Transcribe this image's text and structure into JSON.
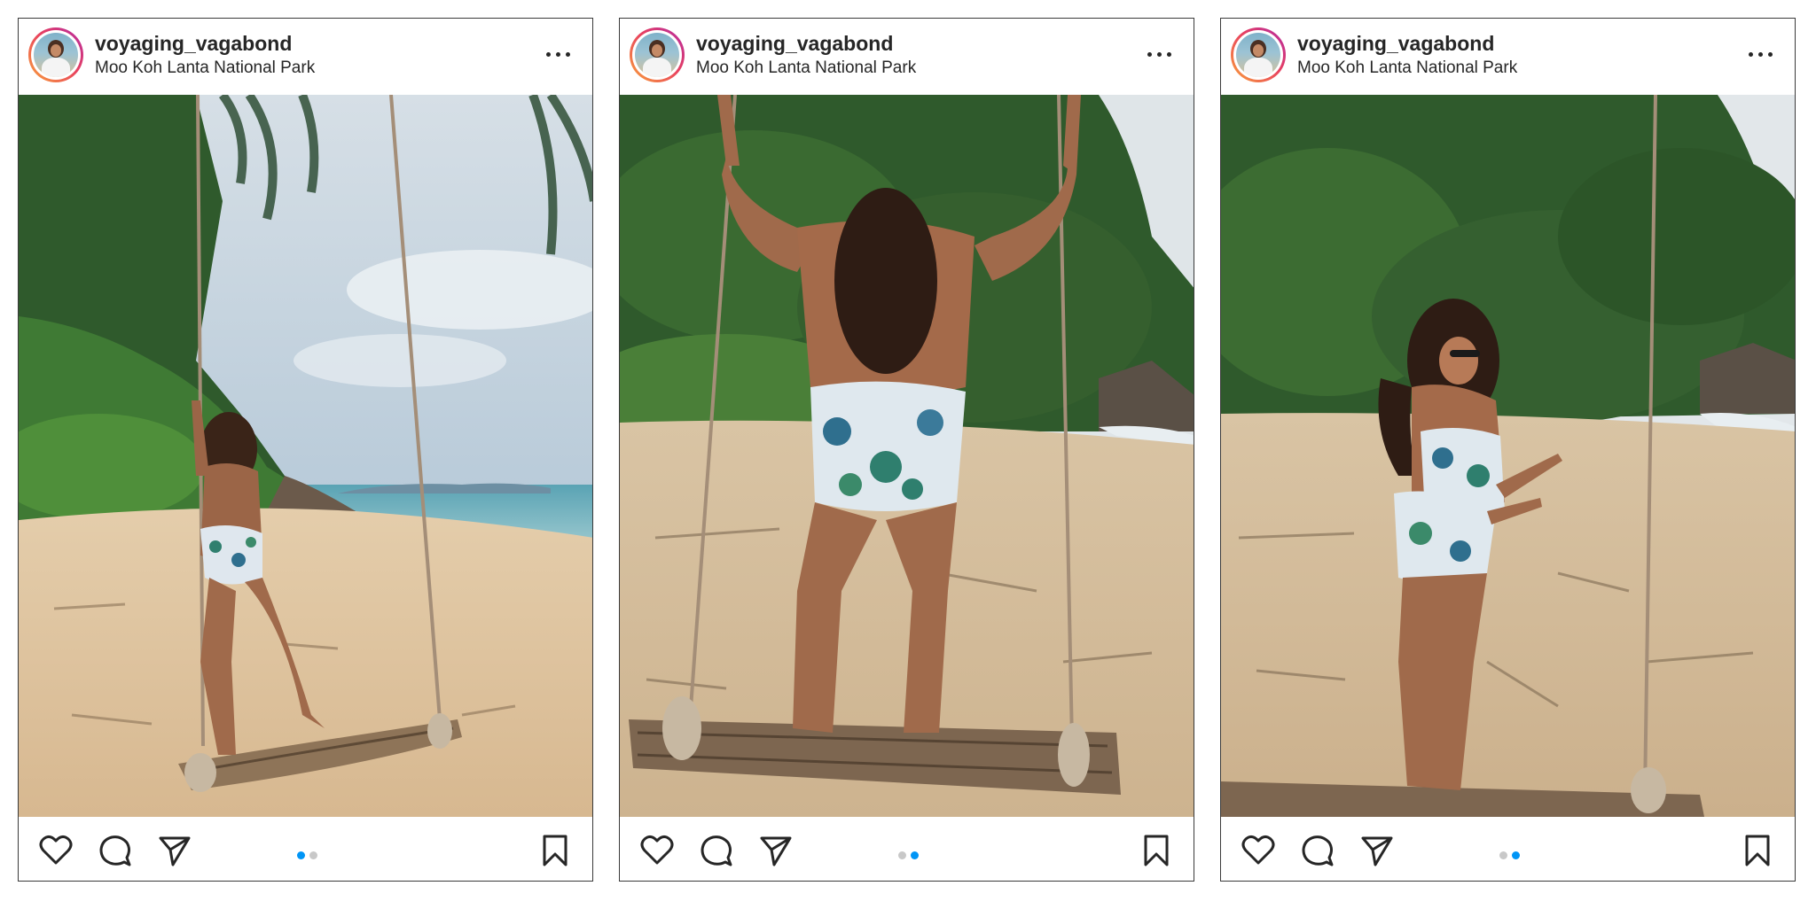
{
  "posts": [
    {
      "username": "voyaging_vagabond",
      "location": "Moo Koh Lanta National Park",
      "photo": "woman on beach swing facing the sea",
      "carousel": {
        "count": 2,
        "active": 1
      }
    },
    {
      "username": "voyaging_vagabond",
      "location": "Moo Koh Lanta National Park",
      "photo": "woman standing on beach swing in front of jungle hill",
      "carousel": {
        "count": 2,
        "active": 2
      }
    },
    {
      "username": "voyaging_vagabond",
      "location": "Moo Koh Lanta National Park",
      "photo": "woman stepping off beach swing wearing sunglasses",
      "carousel": {
        "count": 2,
        "active": 2
      }
    }
  ],
  "icons": [
    "more-icon",
    "heart-icon",
    "comment-icon",
    "send-icon",
    "bookmark-icon"
  ],
  "colors": {
    "dot_active": "#0095f6",
    "dot_inactive": "#c8c8c8",
    "text": "#262626"
  }
}
